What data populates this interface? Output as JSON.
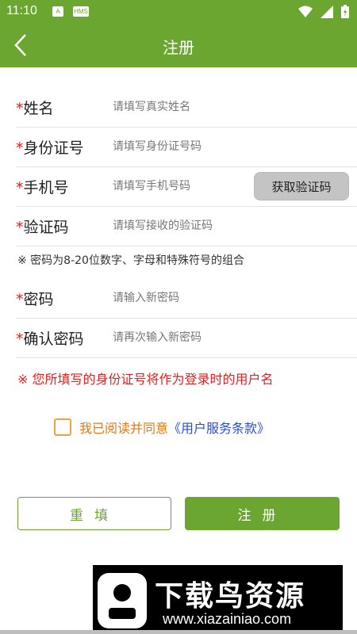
{
  "status_bar": {
    "time": "11:10",
    "icon_a": "A",
    "icon_hms": "HMS"
  },
  "header": {
    "title": "注册",
    "back_icon": "chevron-left-icon"
  },
  "form": {
    "name": {
      "star": "*",
      "label": "姓名",
      "placeholder": "请填写真实姓名",
      "value": ""
    },
    "id_number": {
      "star": "*",
      "label": "身份证号",
      "placeholder": "请填写身份证号码",
      "value": ""
    },
    "phone": {
      "star": "*",
      "label": "手机号",
      "placeholder": "请填写手机号码",
      "value": "",
      "get_code_label": "获取验证码"
    },
    "code": {
      "star": "*",
      "label": "验证码",
      "placeholder": "请填写接收的验证码",
      "value": ""
    },
    "password_note": "※ 密码为8-20位数字、字母和特殊符号的组合",
    "password": {
      "star": "*",
      "label": "密码",
      "placeholder": "请输入新密码",
      "value": ""
    },
    "confirm_password": {
      "star": "*",
      "label": "确认密码",
      "placeholder": "请再次输入新密码",
      "value": ""
    },
    "username_note": "※ 您所填写的身份证号将作为登录时的用户名"
  },
  "agreement": {
    "checked": false,
    "text": "我已阅读并同意",
    "link": "《用户服务条款》"
  },
  "buttons": {
    "reset": "重填",
    "submit": "注册"
  },
  "watermark": {
    "title": "下载鸟资源",
    "url": "www.xiazainiao.com"
  },
  "colors": {
    "primary": "#6aa630",
    "required": "#e02020",
    "agreement_text": "#e0791a",
    "link": "#2a4fcf"
  }
}
